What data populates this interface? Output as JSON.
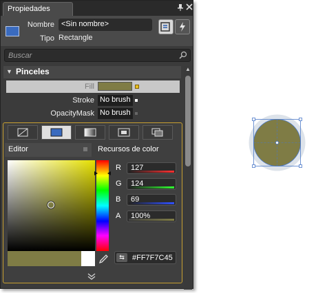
{
  "panel": {
    "tab_title": "Propiedades",
    "name_label": "Nombre",
    "name_value": "<Sin nombre>",
    "type_label": "Tipo",
    "type_value": "Rectangle",
    "search_placeholder": "Buscar"
  },
  "section": {
    "title": "Pinceles",
    "properties": [
      {
        "label": "Fill",
        "value": ""
      },
      {
        "label": "Stroke",
        "value": "No brush"
      },
      {
        "label": "OpacityMask",
        "value": "No brush"
      }
    ]
  },
  "editor": {
    "subtabs": [
      "Editor",
      "Recursos de color"
    ],
    "channels": [
      {
        "label": "R",
        "value": "127"
      },
      {
        "label": "G",
        "value": "124"
      },
      {
        "label": "B",
        "value": "69"
      },
      {
        "label": "A",
        "value": "100%"
      }
    ],
    "hex": "#FF7F7C45"
  },
  "colors": {
    "fill": "#7f7c45",
    "accent": "#c8a030",
    "panel_bg": "#3b3b3b"
  }
}
